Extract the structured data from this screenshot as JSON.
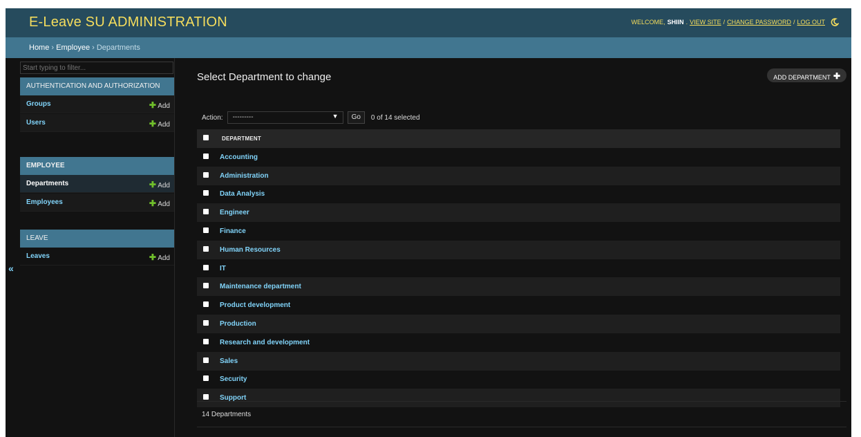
{
  "header": {
    "title": "E-Leave SU ADMINISTRATION",
    "welcome": "WELCOME,",
    "username": "SHIIN",
    "view_site": "VIEW SITE",
    "change_password": "CHANGE PASSWORD",
    "log_out": "LOG OUT",
    "separator": "/",
    "theme_icon": "moon-icon"
  },
  "breadcrumbs": {
    "home": "Home",
    "employee": "Employee",
    "current": "Departments",
    "separator": "›"
  },
  "sidebar": {
    "filter_placeholder": "Start typing to filter...",
    "add_label": "Add",
    "collapse_icon": "«",
    "modules": [
      {
        "title": "AUTHENTICATION AND AUTHORIZATION",
        "items": [
          "Groups",
          "Users"
        ]
      },
      {
        "title": "EMPLOYEE",
        "items": [
          "Departments",
          "Employees"
        ]
      },
      {
        "title": "LEAVE",
        "items": [
          "Leaves"
        ]
      }
    ]
  },
  "content": {
    "title": "Select Department to change",
    "add_button": "ADD DEPARTMENT",
    "action_label": "Action:",
    "action_selected": "---------",
    "go_label": "Go",
    "selected_count": "0 of 14 selected",
    "column_header": "DEPARTMENT",
    "departments": [
      "Accounting",
      "Administration",
      "Data Analysis",
      "Engineer",
      "Finance",
      "Human Resources",
      "IT",
      "Maintenance department",
      "Product development",
      "Production",
      "Research and development",
      "Sales",
      "Security",
      "Support"
    ],
    "paginator": "14 Departments"
  },
  "colors": {
    "header_bg": "#264b5d",
    "breadcrumb_bg": "#417690",
    "title_yellow": "#f5dd5d",
    "link_blue": "#81d4fa",
    "add_green": "#70bf2b"
  }
}
